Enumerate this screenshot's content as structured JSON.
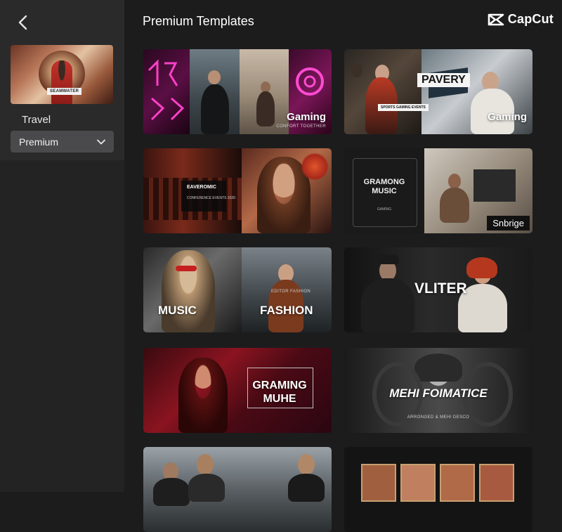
{
  "sidebar": {
    "category_thumb_tag": "SEAMWATER",
    "category_label": "Travel",
    "dropdown_value": "Premium"
  },
  "header": {
    "title": "Premium Templates",
    "brand": "CapCut"
  },
  "templates": [
    {
      "caption": "Gaming",
      "subcaption": "CONFORT TOGETHER"
    },
    {
      "caption": "Gaming",
      "overlay_title": "PAVERY",
      "subcaption": "SPORTS GAMING EVENTS"
    },
    {
      "overlay_title": "EAVEROMIC",
      "subcaption": "CONFERENCE EVENTS 2020"
    },
    {
      "badge": "Snbrige",
      "overlay_title": "GRAMONG MUSIC",
      "subcaption": "GAMING"
    },
    {
      "caption_left": "MUSIC",
      "caption_right": "FASHION",
      "sub_right": "EDITOR FASHION"
    },
    {
      "caption": "VLITER"
    },
    {
      "caption": "GRAMING MUHE"
    },
    {
      "caption": "MEHI FOIMATICE",
      "subcaption": "ARRONGED & MEHI DESCO"
    },
    {},
    {}
  ]
}
